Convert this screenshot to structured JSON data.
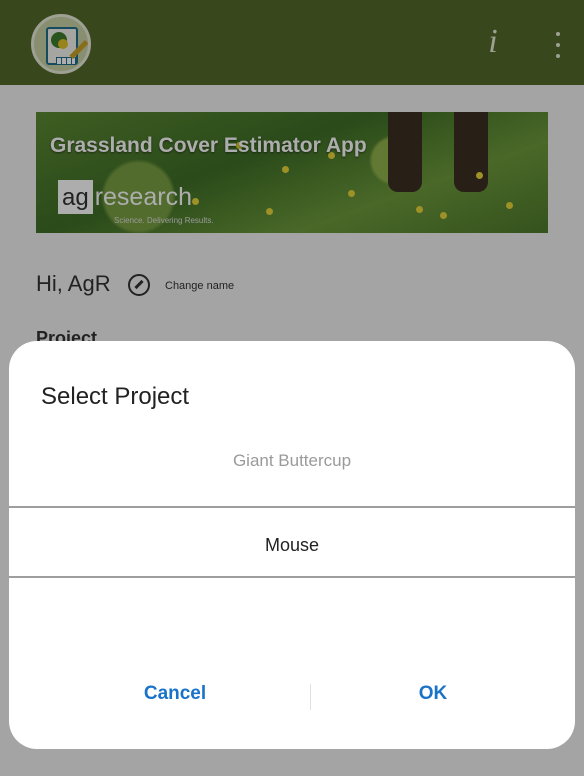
{
  "appbar": {
    "info_glyph": "i",
    "menu_icon": "more-vert-icon",
    "logo_icon": "app-logo-icon",
    "color": "#55692c"
  },
  "banner": {
    "title": "Grassland Cover Estimator App",
    "brand_box": "ag",
    "brand_rest": "research",
    "brand_tag": "Science. Delivering Results."
  },
  "greeting": {
    "text": "Hi, AgR",
    "change_name": "Change name",
    "edit_icon": "edit-icon"
  },
  "project_label": "Project",
  "dialog": {
    "title": "Select Project",
    "options": [
      "Giant Buttercup",
      "Mouse"
    ],
    "selected": "Mouse",
    "cancel_label": "Cancel",
    "ok_label": "OK",
    "accent": "#1a73c8"
  }
}
